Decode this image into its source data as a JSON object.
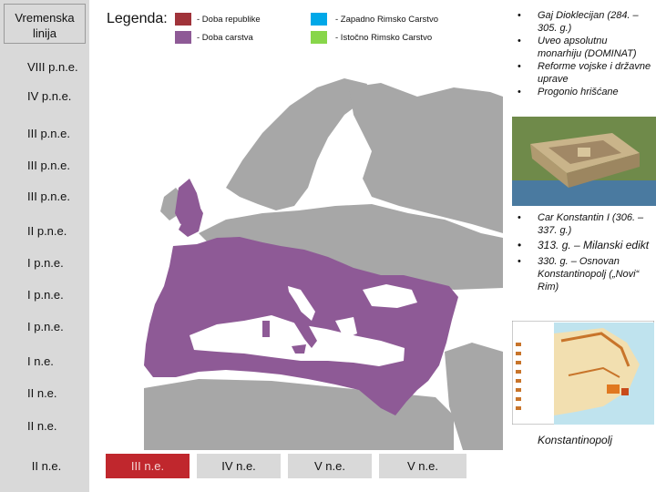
{
  "timeline": {
    "header": "Vremenska linija",
    "rows": [
      "VIII p.n.e.",
      "IV p.n.e.",
      "III p.n.e.",
      "III p.n.e.",
      "III p.n.e.",
      "II p.n.e.",
      "I p.n.e.",
      "I p.n.e.",
      "I p.n.e.",
      "I n.e.",
      "II n.e.",
      "II n.e."
    ],
    "bottom": [
      "II n.e.",
      "III n.e.",
      "IV n.e.",
      "V n.e.",
      "V n.e."
    ],
    "active_index": 1
  },
  "legend": {
    "title": "Legenda:",
    "items": [
      {
        "label": "- Doba republike",
        "color": "#a0333a"
      },
      {
        "label": "- Doba carstva",
        "color": "#8e5a96"
      },
      {
        "label": "- Zapadno Rimsko Carstvo",
        "color": "#00a8e8"
      },
      {
        "label": "- Istočno Rimsko Carstvo",
        "color": "#88d64a"
      }
    ]
  },
  "colors": {
    "empire": "#8e5a96",
    "land": "#a7a7a7",
    "timeline_bg": "#d9d9d9",
    "active": "#c0272d"
  },
  "panel": {
    "top_bullets": [
      "Gaj Dioklecijan (284. – 305. g.)",
      "Uveo apsolutnu monarhiju (DOMINAT)",
      "Reforme vojske i državne uprave",
      "Progonio hrišćane"
    ],
    "mid_bullets": [
      "Car Konstantin I (306. – 337. g.)",
      "313. g. – Milanski edikt",
      "330. g. – Osnovan Konstantinopolj („Novi“ Rim)"
    ],
    "caption": "Konstantinopolj"
  }
}
